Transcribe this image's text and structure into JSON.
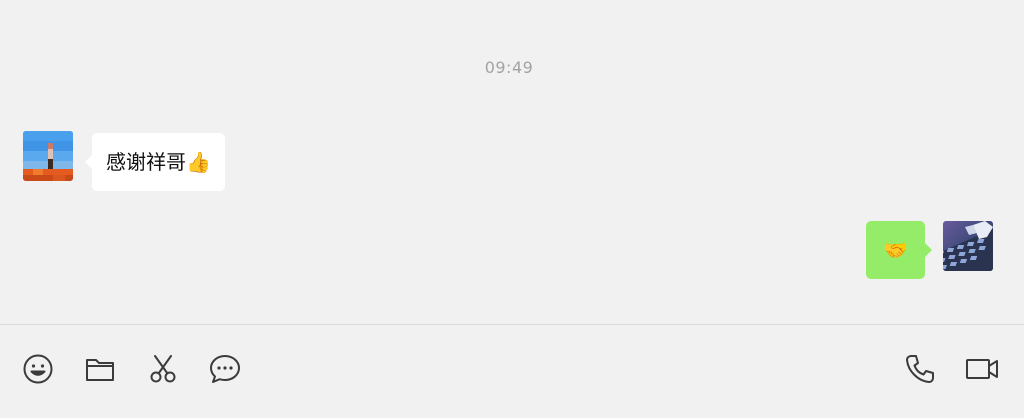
{
  "chat": {
    "timestamp": "09:49",
    "messages": [
      {
        "side": "left",
        "text": "感谢祥哥👍",
        "avatar": "contact-avatar"
      },
      {
        "side": "right",
        "text": "🤝",
        "avatar": "self-avatar"
      }
    ]
  },
  "toolbar": {
    "left_tools": [
      "emoji-icon",
      "folder-icon",
      "scissors-icon",
      "chat-bubble-icon"
    ],
    "right_tools": [
      "phone-icon",
      "video-icon"
    ]
  },
  "colors": {
    "background": "#f1f1f1",
    "sent_bubble": "#95ec69",
    "received_bubble": "#ffffff",
    "timestamp": "#a3a3a3",
    "icon": "#3b3b3b"
  }
}
